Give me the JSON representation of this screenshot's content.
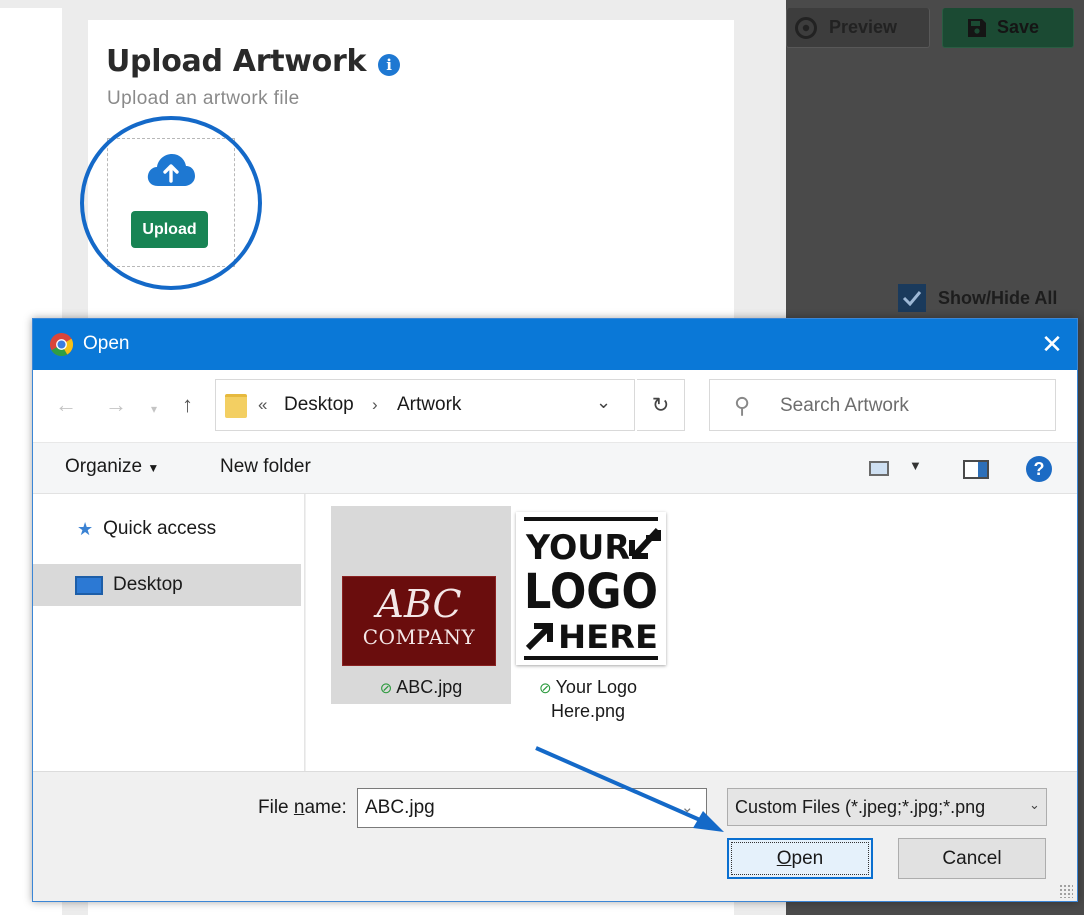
{
  "page": {
    "title": "Upload Artwork",
    "subtitle": "Upload an artwork file",
    "upload_label": "Upload",
    "preview_label": "Preview",
    "save_label": "Save",
    "show_hide_label": "Show/Hide All"
  },
  "dialog": {
    "title": "Open",
    "breadcrumb": [
      "Desktop",
      "Artwork"
    ],
    "search_placeholder": "Search Artwork",
    "organize_label": "Organize",
    "new_folder_label": "New folder",
    "nav_items": [
      {
        "label": "Quick access",
        "icon": "star-pin-icon"
      },
      {
        "label": "Desktop",
        "icon": "desktop-icon",
        "selected": true
      }
    ],
    "files": [
      {
        "name": "ABC.jpg",
        "selected": true,
        "thumb_line1": "ABC",
        "thumb_line2": "COMPANY"
      },
      {
        "name_line1": "Your Logo",
        "name_line2": "Here.png",
        "thumb_line1": "YOUR",
        "thumb_line2": "LOGO",
        "thumb_line3": "HERE"
      }
    ],
    "file_name_label_pre": "File ",
    "file_name_label_u": "n",
    "file_name_label_post": "ame:",
    "file_name_value": "ABC.jpg",
    "file_type_filter": "Custom Files (*.jpeg;*.jpg;*.png",
    "open_label_u": "O",
    "open_label_rest": "pen",
    "cancel_label": "Cancel"
  },
  "colors": {
    "accent_blue": "#0a78d7",
    "upload_green": "#188454",
    "annotation_blue": "#1469c8"
  }
}
